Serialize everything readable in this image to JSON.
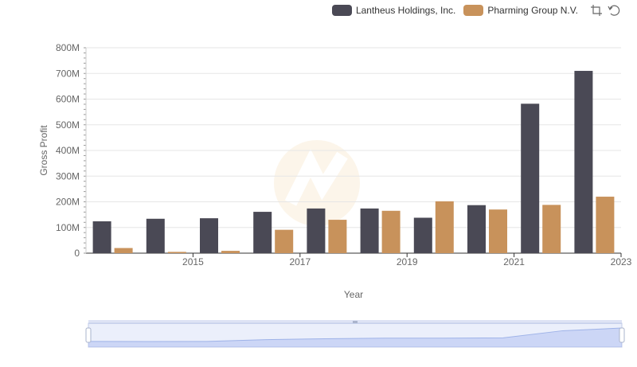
{
  "legend": {
    "items": [
      {
        "label": "Lantheus Holdings, Inc.",
        "color": "#4a4955"
      },
      {
        "label": "Pharming Group N.V.",
        "color": "#c8925b"
      }
    ]
  },
  "toolbox": {
    "icons": [
      "zoom-icon",
      "restore-icon"
    ]
  },
  "chart_data": {
    "type": "bar",
    "xlabel": "Year",
    "ylabel": "Gross Profit",
    "ylim": [
      0,
      800
    ],
    "yunit": "M",
    "yticks": [
      "0",
      "100M",
      "200M",
      "300M",
      "400M",
      "500M",
      "600M",
      "700M",
      "800M"
    ],
    "categories": [
      "2014",
      "2015",
      "2016",
      "2017",
      "2018",
      "2019",
      "2020",
      "2021",
      "2022",
      "2023"
    ],
    "xtick_labels": [
      "2015",
      "2017",
      "2019",
      "2021",
      "2023"
    ],
    "series": [
      {
        "name": "Lantheus Holdings, Inc.",
        "color": "#4a4955",
        "values": [
          124,
          134,
          136,
          161,
          174,
          174,
          138,
          187,
          582,
          710
        ]
      },
      {
        "name": "Pharming Group N.V.",
        "color": "#c8925b",
        "values": [
          20,
          5,
          9,
          91,
          130,
          165,
          202,
          170,
          188,
          220
        ]
      }
    ],
    "grid": true,
    "legend_position": "top-right",
    "datazoom": true
  }
}
